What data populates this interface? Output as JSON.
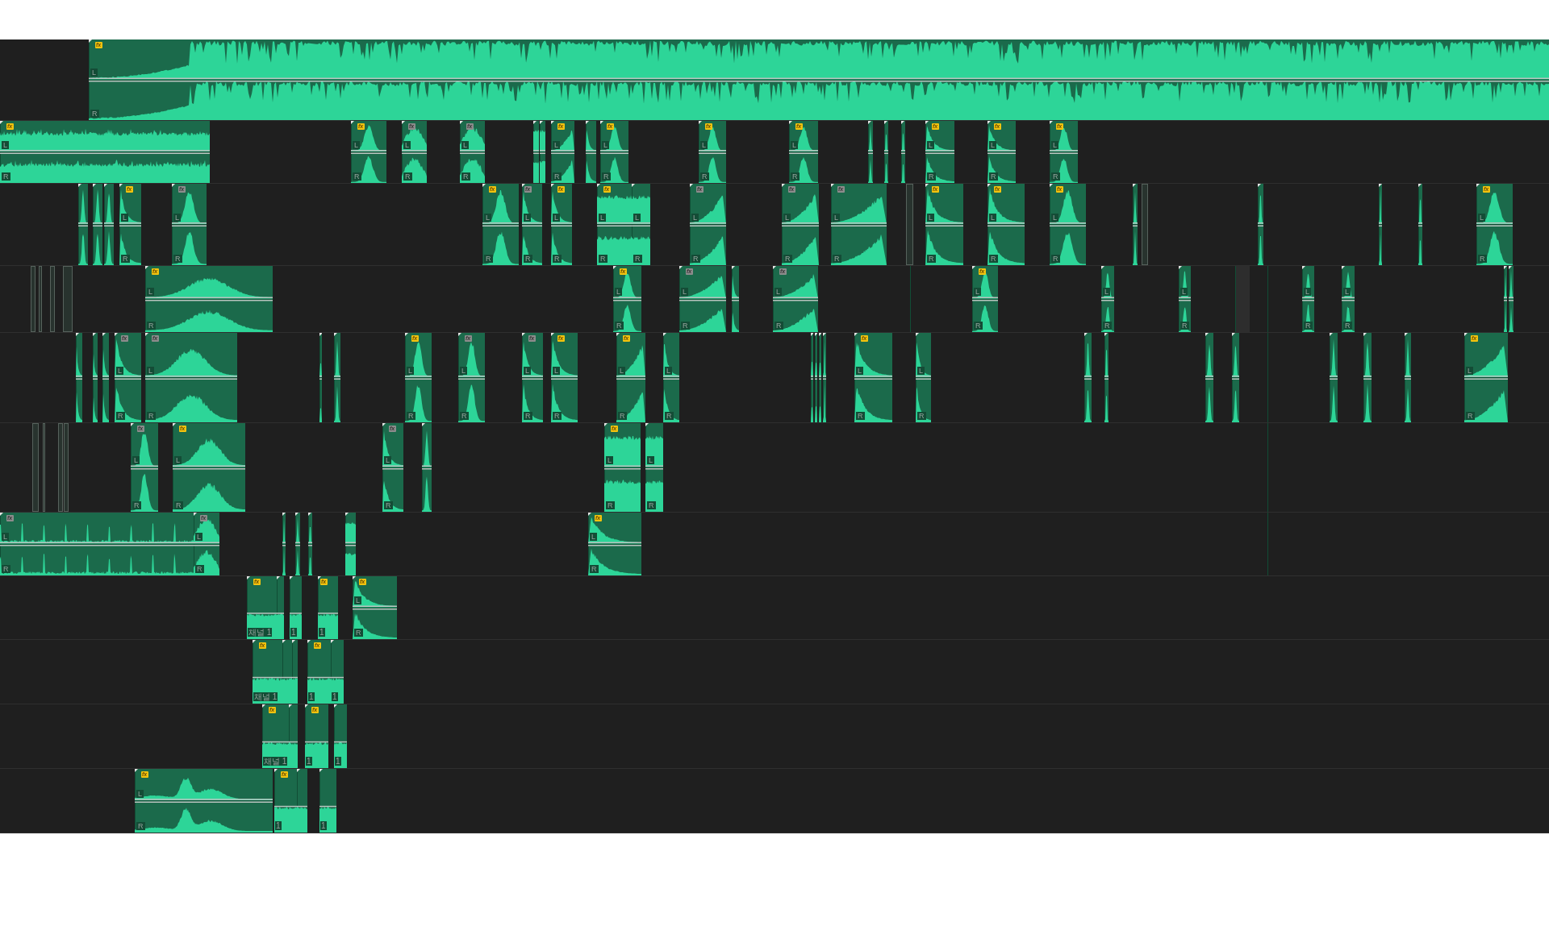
{
  "timeline": {
    "tracks": [
      {
        "clips": [
          {
            "kind": "stereo",
            "badge": {
              "text": "fx",
              "active": true
            },
            "labels": [
              "L",
              "R"
            ]
          }
        ]
      },
      {
        "clips": [
          {
            "kind": "stereo",
            "badge": {
              "text": "fx",
              "active": true
            },
            "labels": [
              "L",
              "R"
            ]
          },
          {
            "kind": "stereo",
            "badge": {
              "text": "fx",
              "active": true
            },
            "labels": [
              "L",
              "R"
            ]
          },
          {
            "kind": "stereo",
            "badge": {
              "text": "fx",
              "active": false
            },
            "labels": [
              "L",
              "R"
            ]
          },
          {
            "kind": "stereo",
            "badge": {
              "text": "fx",
              "active": false
            },
            "labels": [
              "L",
              "R"
            ]
          },
          {
            "kind": "stereo"
          },
          {
            "kind": "stereo"
          },
          {
            "kind": "stereo",
            "badge": {
              "text": "fx",
              "active": true
            },
            "labels": [
              "L",
              "R"
            ]
          },
          {
            "kind": "stereo"
          },
          {
            "kind": "stereo",
            "badge": {
              "text": "fx",
              "active": true
            },
            "labels": [
              "L",
              "R"
            ]
          },
          {
            "kind": "stereo",
            "badge": {
              "text": "fx",
              "active": true
            },
            "labels": [
              "L",
              "R"
            ]
          },
          {
            "kind": "stereo",
            "badge": {
              "text": "fx",
              "active": true
            },
            "labels": [
              "L",
              "R"
            ]
          },
          {
            "kind": "stereo"
          },
          {
            "kind": "stereo"
          },
          {
            "kind": "stereo"
          },
          {
            "kind": "stereo",
            "badge": {
              "text": "fx",
              "active": true
            },
            "labels": [
              "L",
              "R"
            ]
          },
          {
            "kind": "stereo",
            "badge": {
              "text": "fx",
              "active": true
            },
            "labels": [
              "L",
              "R"
            ]
          },
          {
            "kind": "stereo",
            "badge": {
              "text": "fx",
              "active": true
            },
            "labels": [
              "L",
              "R"
            ]
          }
        ]
      },
      {
        "clips": [
          {
            "kind": "stereo"
          },
          {
            "kind": "stereo"
          },
          {
            "kind": "stereo"
          },
          {
            "kind": "stereo",
            "badge": {
              "text": "fx",
              "active": true
            },
            "labels": [
              "L",
              "R"
            ]
          },
          {
            "kind": "stereo",
            "badge": {
              "text": "fx",
              "active": false
            },
            "labels": [
              "L",
              "R"
            ]
          },
          {
            "kind": "stereo",
            "badge": {
              "text": "fx",
              "active": true
            },
            "labels": [
              "L",
              "R"
            ]
          },
          {
            "kind": "stereo",
            "badge": {
              "text": "fx",
              "active": false
            },
            "labels": [
              "L",
              "R"
            ]
          },
          {
            "kind": "stereo",
            "badge": {
              "text": "fx",
              "active": true
            },
            "labels": [
              "L",
              "R"
            ]
          },
          {
            "kind": "stereo",
            "badge": {
              "text": "fx",
              "active": true
            },
            "labels": [
              "L",
              "R"
            ]
          },
          {
            "kind": "stereo",
            "labels": [
              "L",
              "R"
            ]
          },
          {
            "kind": "stereo",
            "badge": {
              "text": "fx",
              "active": false
            },
            "labels": [
              "L",
              "R"
            ]
          },
          {
            "kind": "stereo",
            "badge": {
              "text": "fx",
              "active": false
            },
            "labels": [
              "L",
              "R"
            ]
          },
          {
            "kind": "stereo",
            "badge": {
              "text": "fx",
              "active": false
            },
            "labels": [
              "L",
              "R"
            ]
          },
          {
            "kind": "ghost"
          },
          {
            "kind": "stereo",
            "badge": {
              "text": "fx",
              "active": true
            },
            "labels": [
              "L",
              "R"
            ]
          },
          {
            "kind": "stereo",
            "badge": {
              "text": "fx",
              "active": true
            },
            "labels": [
              "L",
              "R"
            ]
          },
          {
            "kind": "stereo",
            "badge": {
              "text": "fx",
              "active": true
            },
            "labels": [
              "L",
              "R"
            ]
          },
          {
            "kind": "stereo"
          },
          {
            "kind": "ghost"
          },
          {
            "kind": "stereo"
          },
          {
            "kind": "stereo"
          },
          {
            "kind": "stereo"
          },
          {
            "kind": "stereo",
            "badge": {
              "text": "fx",
              "active": true
            },
            "labels": [
              "L",
              "R"
            ]
          }
        ]
      },
      {
        "clips": [
          {
            "kind": "ghost"
          },
          {
            "kind": "ghost"
          },
          {
            "kind": "ghost"
          },
          {
            "kind": "ghost"
          },
          {
            "kind": "stereo",
            "badge": {
              "text": "fx",
              "active": true
            },
            "labels": [
              "L",
              "R"
            ]
          },
          {
            "kind": "stereo",
            "badge": {
              "text": "fx",
              "active": true
            },
            "labels": [
              "L",
              "R"
            ]
          },
          {
            "kind": "stereo",
            "badge": {
              "text": "fx",
              "active": false
            },
            "labels": [
              "L",
              "R"
            ]
          },
          {
            "kind": "stereo"
          },
          {
            "kind": "stereo",
            "badge": {
              "text": "fx",
              "active": false
            },
            "labels": [
              "L",
              "R"
            ]
          },
          {
            "kind": "hairline"
          },
          {
            "kind": "stereo",
            "badge": {
              "text": "fx",
              "active": true
            },
            "labels": [
              "L",
              "R"
            ]
          },
          {
            "kind": "stereo",
            "labels": [
              "L",
              "R"
            ]
          },
          {
            "kind": "stereo",
            "labels": [
              "L",
              "R"
            ]
          },
          {
            "kind": "gap"
          },
          {
            "kind": "hairline"
          },
          {
            "kind": "stereo",
            "labels": [
              "L",
              "R"
            ]
          },
          {
            "kind": "stereo",
            "labels": [
              "L",
              "R"
            ]
          },
          {
            "kind": "stereo"
          },
          {
            "kind": "stereo"
          }
        ]
      },
      {
        "clips": [
          {
            "kind": "stereo"
          },
          {
            "kind": "stereo"
          },
          {
            "kind": "stereo"
          },
          {
            "kind": "stereo",
            "badge": {
              "text": "fx",
              "active": false
            },
            "labels": [
              "L",
              "R"
            ]
          },
          {
            "kind": "stereo",
            "badge": {
              "text": "fx",
              "active": false
            },
            "labels": [
              "L",
              "R"
            ]
          },
          {
            "kind": "stereo"
          },
          {
            "kind": "stereo"
          },
          {
            "kind": "stereo",
            "badge": {
              "text": "fx",
              "active": true
            },
            "labels": [
              "L",
              "R"
            ]
          },
          {
            "kind": "stereo",
            "badge": {
              "text": "fx",
              "active": false
            },
            "labels": [
              "L",
              "R"
            ]
          },
          {
            "kind": "stereo",
            "badge": {
              "text": "fx",
              "active": false
            },
            "labels": [
              "L",
              "R"
            ]
          },
          {
            "kind": "stereo",
            "badge": {
              "text": "fx",
              "active": true
            },
            "labels": [
              "L",
              "R"
            ]
          },
          {
            "kind": "stereo",
            "badge": {
              "text": "fx",
              "active": true
            },
            "labels": [
              "L",
              "R"
            ]
          },
          {
            "kind": "stereo",
            "labels": [
              "L",
              "R"
            ]
          },
          {
            "kind": "stereo"
          },
          {
            "kind": "stereo"
          },
          {
            "kind": "stereo"
          },
          {
            "kind": "stereo"
          },
          {
            "kind": "stereo",
            "badge": {
              "text": "fx",
              "active": true
            },
            "labels": [
              "L",
              "R"
            ]
          },
          {
            "kind": "stereo",
            "labels": [
              "L",
              "R"
            ]
          },
          {
            "kind": "stereo"
          },
          {
            "kind": "stereo"
          },
          {
            "kind": "stereo"
          },
          {
            "kind": "stereo"
          },
          {
            "kind": "hairline"
          },
          {
            "kind": "stereo"
          },
          {
            "kind": "stereo"
          },
          {
            "kind": "stereo"
          },
          {
            "kind": "stereo",
            "badge": {
              "text": "fx",
              "active": true
            },
            "labels": [
              "L",
              "R"
            ]
          }
        ]
      },
      {
        "clips": [
          {
            "kind": "ghost"
          },
          {
            "kind": "ghost"
          },
          {
            "kind": "ghost"
          },
          {
            "kind": "ghost"
          },
          {
            "kind": "stereo",
            "badge": {
              "text": "fx",
              "active": false
            },
            "labels": [
              "L",
              "R"
            ]
          },
          {
            "kind": "stereo",
            "badge": {
              "text": "fx",
              "active": true
            },
            "labels": [
              "L",
              "R"
            ]
          },
          {
            "kind": "stereo",
            "badge": {
              "text": "fx",
              "active": false
            },
            "labels": [
              "L",
              "R"
            ]
          },
          {
            "kind": "stereo"
          },
          {
            "kind": "stereo",
            "badge": {
              "text": "fx",
              "active": true
            },
            "labels": [
              "L",
              "R"
            ]
          },
          {
            "kind": "stereo",
            "labels": [
              "L",
              "R"
            ]
          },
          {
            "kind": "hairline"
          }
        ]
      },
      {
        "clips": [
          {
            "kind": "stereo",
            "badge": {
              "text": "fx",
              "active": false
            },
            "labels": [
              "L",
              "R"
            ]
          },
          {
            "kind": "stereo",
            "badge": {
              "text": "fx",
              "active": false
            },
            "labels": [
              "L",
              "R"
            ]
          },
          {
            "kind": "stereo"
          },
          {
            "kind": "stereo"
          },
          {
            "kind": "stereo"
          },
          {
            "kind": "stereo"
          },
          {
            "kind": "stereo",
            "badge": {
              "text": "fx",
              "active": true
            },
            "labels": [
              "L",
              "R"
            ]
          },
          {
            "kind": "hairline"
          }
        ]
      },
      {
        "clips": [
          {
            "kind": "mono",
            "badge": {
              "text": "fx",
              "active": true
            },
            "labels": [
              "채널 1"
            ]
          },
          {
            "kind": "mono"
          },
          {
            "kind": "mono",
            "labels": [
              "1"
            ]
          },
          {
            "kind": "mono",
            "badge": {
              "text": "fx",
              "active": true
            },
            "labels": [
              "1"
            ]
          },
          {
            "kind": "stereo",
            "badge": {
              "text": "fx",
              "active": true
            },
            "labels": [
              "L",
              "R"
            ]
          }
        ]
      },
      {
        "clips": [
          {
            "kind": "mono",
            "badge": {
              "text": "fx",
              "active": true
            },
            "labels": [
              "채널 1"
            ]
          },
          {
            "kind": "mono"
          },
          {
            "kind": "mono"
          },
          {
            "kind": "mono",
            "badge": {
              "text": "fx",
              "active": true
            },
            "labels": [
              "1"
            ]
          },
          {
            "kind": "mono",
            "labels": [
              "1"
            ]
          }
        ]
      },
      {
        "clips": [
          {
            "kind": "mono",
            "badge": {
              "text": "fx",
              "active": true
            },
            "labels": [
              "채널 1"
            ]
          },
          {
            "kind": "mono"
          },
          {
            "kind": "mono",
            "badge": {
              "text": "fx",
              "active": true
            },
            "labels": [
              "1"
            ]
          },
          {
            "kind": "mono",
            "labels": [
              "1"
            ]
          }
        ]
      },
      {
        "clips": [
          {
            "kind": "stereo",
            "badge": {
              "text": "fx",
              "active": true
            },
            "labels": [
              "L",
              "R"
            ]
          },
          {
            "kind": "mono",
            "badge": {
              "text": "fx",
              "active": true
            },
            "labels": [
              "1"
            ]
          },
          {
            "kind": "mono"
          },
          {
            "kind": "mono",
            "labels": [
              "1"
            ]
          }
        ]
      }
    ]
  }
}
